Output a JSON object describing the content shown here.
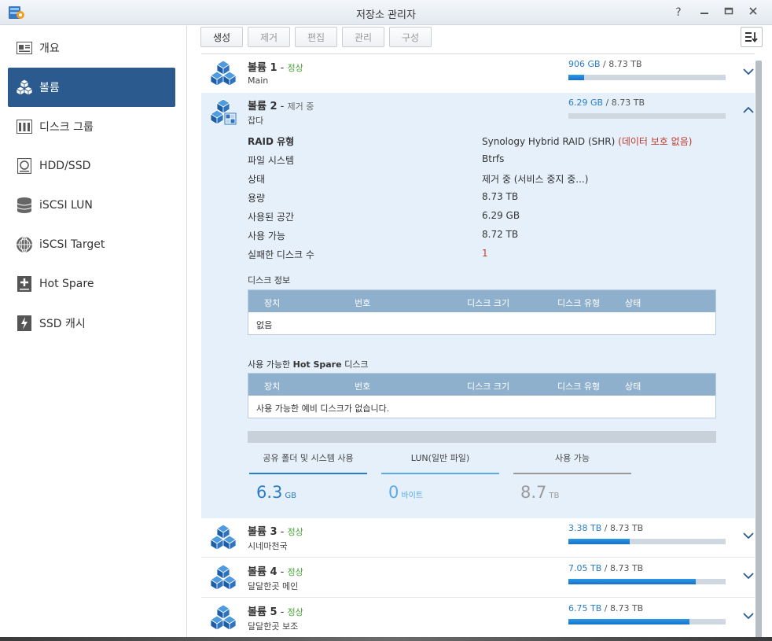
{
  "window": {
    "title": "저장소 관리자",
    "controls": [
      "help-icon",
      "minimize-icon",
      "maximize-icon",
      "close-icon"
    ]
  },
  "sidebar": {
    "items": [
      {
        "label": "개요",
        "icon": "overview-icon"
      },
      {
        "label": "볼륨",
        "icon": "volume-icon",
        "active": true
      },
      {
        "label": "디스크 그룹",
        "icon": "disk-group-icon"
      },
      {
        "label": "HDD/SSD",
        "icon": "hdd-icon"
      },
      {
        "label": "iSCSI LUN",
        "icon": "iscsi-lun-icon"
      },
      {
        "label": "iSCSI Target",
        "icon": "iscsi-target-icon"
      },
      {
        "label": "Hot Spare",
        "icon": "hot-spare-icon"
      },
      {
        "label": "SSD 캐시",
        "icon": "ssd-cache-icon"
      }
    ]
  },
  "toolbar": {
    "create": "생성",
    "remove": "제거",
    "edit": "편집",
    "manage": "관리",
    "configure": "구성"
  },
  "volumes": [
    {
      "name": "볼륨 1",
      "status": "정상",
      "desc": "Main",
      "used": "906 GB",
      "total": "8.73 TB",
      "fraction": 0.1
    },
    {
      "name": "볼륨 2",
      "status": "제거 중",
      "desc": "잡다",
      "used": "6.29 GB",
      "total": "8.73 TB",
      "fraction": 0.0
    },
    {
      "name": "볼륨 3",
      "status": "정상",
      "desc": "시네마천국",
      "used": "3.38 TB",
      "total": "8.73 TB",
      "fraction": 0.39
    },
    {
      "name": "볼륨 4",
      "status": "정상",
      "desc": "달달한곳 메인",
      "used": "7.05 TB",
      "total": "8.73 TB",
      "fraction": 0.81
    },
    {
      "name": "볼륨 5",
      "status": "정상",
      "desc": "달달한곳 보조",
      "used": "6.75 TB",
      "total": "8.73 TB",
      "fraction": 0.77
    }
  ],
  "details": {
    "raid_type_label": "RAID 유형",
    "raid_type_value": "Synology Hybrid RAID (SHR)",
    "raid_type_warning": "(데이터 보호 없음)",
    "fs_label": "파일 시스템",
    "fs_value": "Btrfs",
    "state_label": "상태",
    "state_value": "제거 중 (서비스 중지 중...)",
    "capacity_label": "용량",
    "capacity_value": "8.73 TB",
    "used_label": "사용된 공간",
    "used_value": "6.29 GB",
    "avail_label": "사용 가능",
    "avail_value": "8.72 TB",
    "failed_label": "실패한 디스크 수",
    "failed_value": "1"
  },
  "disk_info": {
    "title": "디스크 정보",
    "columns": [
      "장치",
      "번호",
      "디스크 크기",
      "디스크 유형",
      "상태"
    ],
    "empty": "없음"
  },
  "hot_spare": {
    "title_prefix": "사용 가능한",
    "title_bold": "Hot Spare",
    "title_suffix": "디스크",
    "columns": [
      "장치",
      "번호",
      "디스크 크기",
      "디스크 유형",
      "상태"
    ],
    "empty": "사용 가능한 예비 디스크가 없습니다."
  },
  "stats": [
    {
      "label": "공유 폴더 및 시스템 사용",
      "value": "6.3",
      "unit": "GB",
      "color": "#2a7cc7"
    },
    {
      "label": "LUN(일반 파일)",
      "value": "0",
      "unit": "바이트",
      "color": "#5aaae5"
    },
    {
      "label": "사용 가능",
      "value": "8.7",
      "unit": "TB",
      "color": "#999999"
    }
  ]
}
